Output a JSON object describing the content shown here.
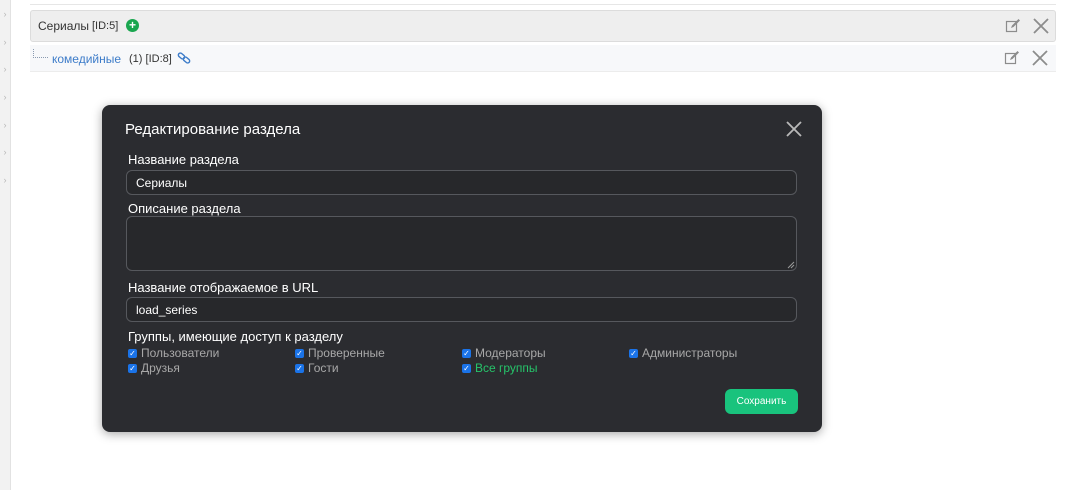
{
  "tree": {
    "rows": [
      {
        "title": "Сериалы",
        "id_text": "[ID:5]"
      },
      {
        "title": "комедийные",
        "count": "(1)",
        "id_text": "[ID:8]"
      }
    ]
  },
  "modal": {
    "title": "Редактирование раздела",
    "fields": {
      "name_label": "Название раздела",
      "name_value": "Сериалы",
      "description_label": "Описание раздела",
      "description_value": "",
      "url_label": "Название отображаемое в URL",
      "url_value": "load_series"
    },
    "groups_label": "Группы, имеющие доступ к разделу",
    "groups": [
      {
        "label": "Пользователи",
        "checked": true
      },
      {
        "label": "Проверенные",
        "checked": true
      },
      {
        "label": "Модераторы",
        "checked": true
      },
      {
        "label": "Администраторы",
        "checked": true
      },
      {
        "label": "Друзья",
        "checked": true
      },
      {
        "label": "Гости",
        "checked": true
      },
      {
        "label": "Все группы",
        "checked": true
      }
    ],
    "save_label": "Сохранить"
  },
  "colors": {
    "modal_bg": "#2b2c30",
    "accent_green": "#19c37d",
    "link_blue": "#3d7cc9",
    "all_groups_green": "#26c46a"
  }
}
